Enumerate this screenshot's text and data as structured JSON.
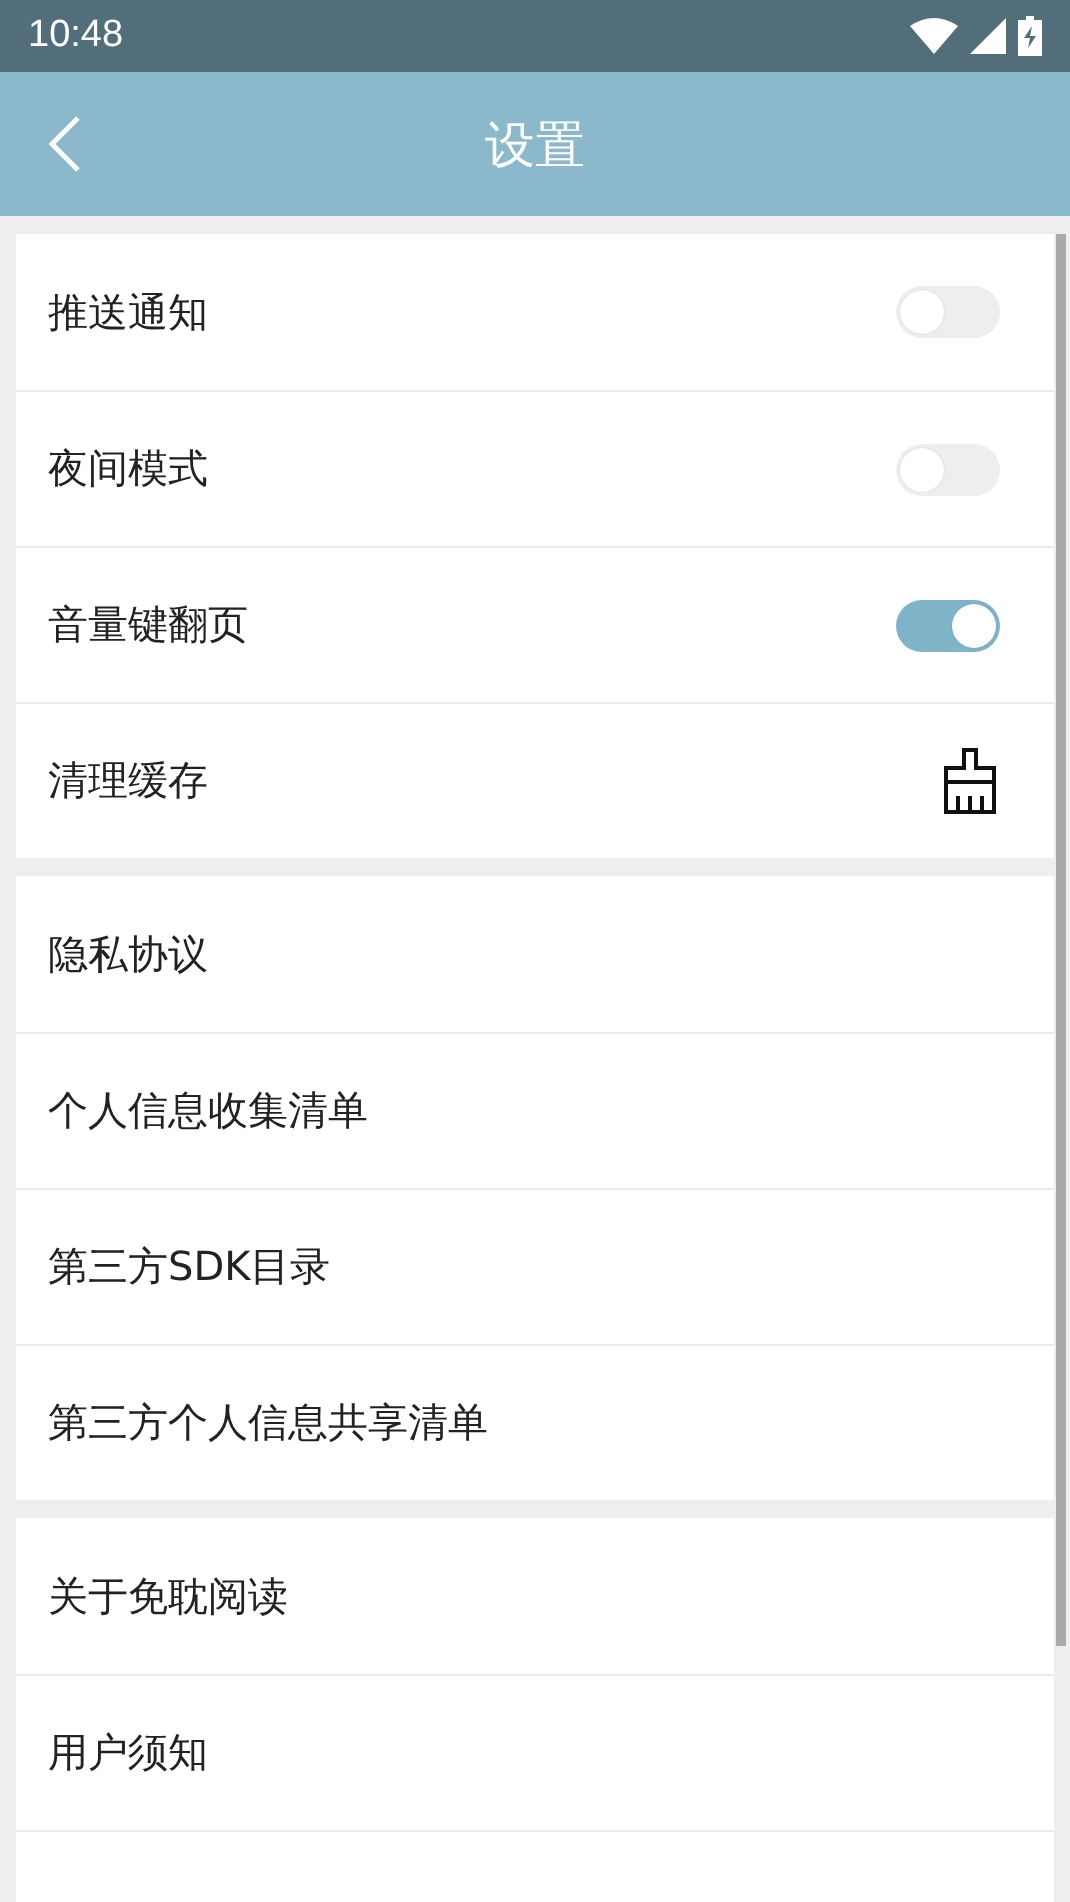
{
  "status_bar": {
    "time": "10:48"
  },
  "header": {
    "title": "设置"
  },
  "groups": [
    {
      "items": [
        {
          "label": "推送通知",
          "kind": "toggle",
          "on": false
        },
        {
          "label": "夜间模式",
          "kind": "toggle",
          "on": false
        },
        {
          "label": "音量键翻页",
          "kind": "toggle",
          "on": true
        },
        {
          "label": "清理缓存",
          "kind": "clean"
        }
      ]
    },
    {
      "items": [
        {
          "label": "隐私协议",
          "kind": "link"
        },
        {
          "label": "个人信息收集清单",
          "kind": "link"
        },
        {
          "label": "第三方SDK目录",
          "kind": "link"
        },
        {
          "label": "第三方个人信息共享清单",
          "kind": "link"
        }
      ]
    },
    {
      "items": [
        {
          "label": "关于免耽阅读",
          "kind": "link"
        },
        {
          "label": "用户须知",
          "kind": "link"
        }
      ]
    }
  ]
}
